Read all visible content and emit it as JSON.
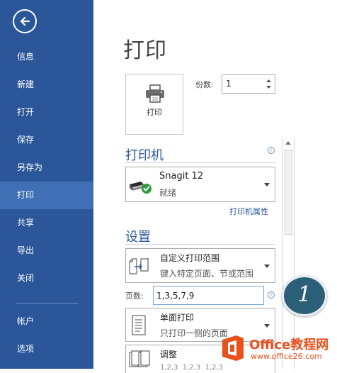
{
  "sidebar": {
    "back_icon": "back-arrow-icon",
    "items": [
      {
        "label": "信息"
      },
      {
        "label": "新建"
      },
      {
        "label": "打开"
      },
      {
        "label": "保存"
      },
      {
        "label": "另存为"
      },
      {
        "label": "打印",
        "active": true
      },
      {
        "label": "共享"
      },
      {
        "label": "导出"
      },
      {
        "label": "关闭"
      },
      {
        "label": "帐户"
      },
      {
        "label": "选项"
      }
    ],
    "bg_color": "#2b579a",
    "active_color": "#3f6fb4"
  },
  "main": {
    "title": "打印",
    "print_button": {
      "label": "打印",
      "icon": "printer-icon"
    },
    "copies": {
      "label": "份数:",
      "value": "1"
    }
  },
  "printer": {
    "heading": "打印机",
    "name": "Snagit 12",
    "status": "就绪",
    "properties_link": "打印机属性"
  },
  "settings": {
    "heading": "设置",
    "range": {
      "main": "自定义打印范围",
      "sub": "键入特定页面、节或范围"
    },
    "pages": {
      "label": "页数:",
      "value": "1,3,5,7,9"
    },
    "sides": {
      "main": "单面打印",
      "sub": "只打印一侧的页面"
    },
    "collate": {
      "main": "调整",
      "sub": "1,2,3  1,2,3  1,2,3"
    }
  },
  "annotation": {
    "step_number": "1"
  },
  "watermark": {
    "brand": "Office教程网",
    "url": "www.office26.com"
  },
  "colors": {
    "accent": "#2b579a",
    "badge": "#2c6079",
    "watermark": "#e8501c"
  }
}
